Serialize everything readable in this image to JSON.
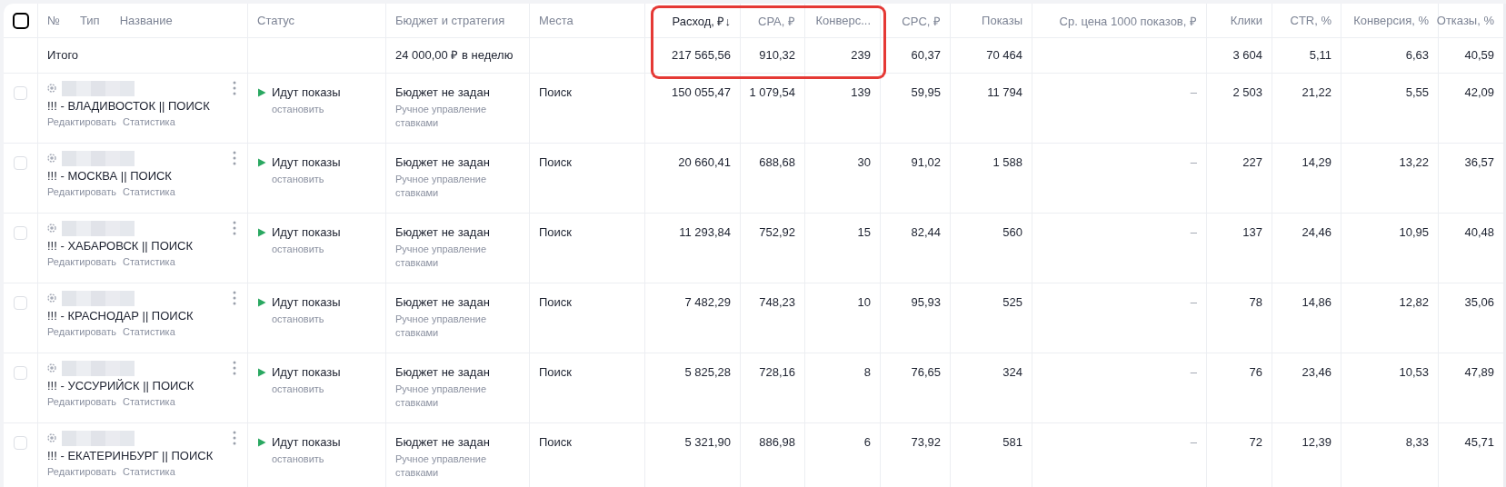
{
  "header": {
    "select_all": {
      "checked": false
    },
    "name_labels": [
      "№",
      "Тип",
      "Название"
    ]
  },
  "totals_label": "Итого",
  "columns": [
    {
      "label": "Статус",
      "kind": "status",
      "sorted": false,
      "highlighted": false
    },
    {
      "label": "Бюджет и стратегия",
      "kind": "budget",
      "sorted": false,
      "highlighted": false,
      "total": "24 000,00 ₽ в неделю"
    },
    {
      "label": "Места",
      "kind": "places",
      "sorted": false,
      "highlighted": false
    },
    {
      "label": "Расход, ₽",
      "kind": "metric",
      "sorted": true,
      "sort_mark": "↓",
      "highlighted": true,
      "total": "217 565,56"
    },
    {
      "label": "CPA, ₽",
      "kind": "metric",
      "sorted": false,
      "highlighted": true,
      "total": "910,32"
    },
    {
      "label": "Конверс...",
      "kind": "metric",
      "sorted": false,
      "highlighted": true,
      "total": "239"
    },
    {
      "label": "CPC, ₽",
      "kind": "metric",
      "sorted": false,
      "highlighted": false,
      "total": "60,37"
    },
    {
      "label": "Показы",
      "kind": "metric",
      "sorted": false,
      "highlighted": false,
      "total": "70 464"
    },
    {
      "label": "Ср. цена 1000 показов, ₽",
      "kind": "metric",
      "sorted": false,
      "highlighted": false
    },
    {
      "label": "Клики",
      "kind": "metric",
      "sorted": false,
      "highlighted": false,
      "total": "3 604"
    },
    {
      "label": "CTR, %",
      "kind": "metric",
      "sorted": false,
      "highlighted": false,
      "total": "5,11"
    },
    {
      "label": "Конверсия, %",
      "kind": "metric",
      "sorted": false,
      "highlighted": false,
      "total": "6,63"
    },
    {
      "label": "Отказы, %",
      "kind": "metric",
      "sorted": false,
      "highlighted": false,
      "total": "40,59"
    }
  ],
  "rows": [
    {
      "checked": false,
      "name": "!!! - ВЛАДИВОСТОК || ПОИСК",
      "edit": "Редактировать",
      "stats": "Статистика",
      "status": "Идут показы",
      "running": true,
      "action": "остановить",
      "budget": "Бюджет не задан",
      "strategy": "Ручное управление ставками",
      "places": "Поиск",
      "metrics": [
        "150 055,47",
        "1 079,54",
        "139",
        "59,95",
        "11 794",
        "–",
        "2 503",
        "21,22",
        "5,55",
        "42,09"
      ]
    },
    {
      "checked": false,
      "name": "!!! - МОСКВА || ПОИСК",
      "edit": "Редактировать",
      "stats": "Статистика",
      "status": "Идут показы",
      "running": true,
      "action": "остановить",
      "budget": "Бюджет не задан",
      "strategy": "Ручное управление ставками",
      "places": "Поиск",
      "metrics": [
        "20 660,41",
        "688,68",
        "30",
        "91,02",
        "1 588",
        "–",
        "227",
        "14,29",
        "13,22",
        "36,57"
      ]
    },
    {
      "checked": false,
      "name": "!!! - ХАБАРОВСК || ПОИСК",
      "edit": "Редактировать",
      "stats": "Статистика",
      "status": "Идут показы",
      "running": true,
      "action": "остановить",
      "budget": "Бюджет не задан",
      "strategy": "Ручное управление ставками",
      "places": "Поиск",
      "metrics": [
        "11 293,84",
        "752,92",
        "15",
        "82,44",
        "560",
        "–",
        "137",
        "24,46",
        "10,95",
        "40,48"
      ]
    },
    {
      "checked": false,
      "name": "!!! - КРАСНОДАР || ПОИСК",
      "edit": "Редактировать",
      "stats": "Статистика",
      "status": "Идут показы",
      "running": true,
      "action": "остановить",
      "budget": "Бюджет не задан",
      "strategy": "Ручное управление ставками",
      "places": "Поиск",
      "metrics": [
        "7 482,29",
        "748,23",
        "10",
        "95,93",
        "525",
        "–",
        "78",
        "14,86",
        "12,82",
        "35,06"
      ]
    },
    {
      "checked": false,
      "name": "!!! - УССУРИЙСК || ПОИСК",
      "edit": "Редактировать",
      "stats": "Статистика",
      "status": "Идут показы",
      "running": true,
      "action": "остановить",
      "budget": "Бюджет не задан",
      "strategy": "Ручное управление ставками",
      "places": "Поиск",
      "metrics": [
        "5 825,28",
        "728,16",
        "8",
        "76,65",
        "324",
        "–",
        "76",
        "23,46",
        "10,53",
        "47,89"
      ]
    },
    {
      "checked": false,
      "name": "!!! - ЕКАТЕРИНБУРГ || ПОИСК",
      "edit": "Редактировать",
      "stats": "Статистика",
      "status": "Идут показы",
      "running": true,
      "action": "остановить",
      "budget": "Бюджет не задан",
      "strategy": "Ручное управление ставками",
      "places": "Поиск",
      "metrics": [
        "5 321,90",
        "886,98",
        "6",
        "73,92",
        "581",
        "–",
        "72",
        "12,39",
        "8,33",
        "45,71"
      ]
    }
  ]
}
